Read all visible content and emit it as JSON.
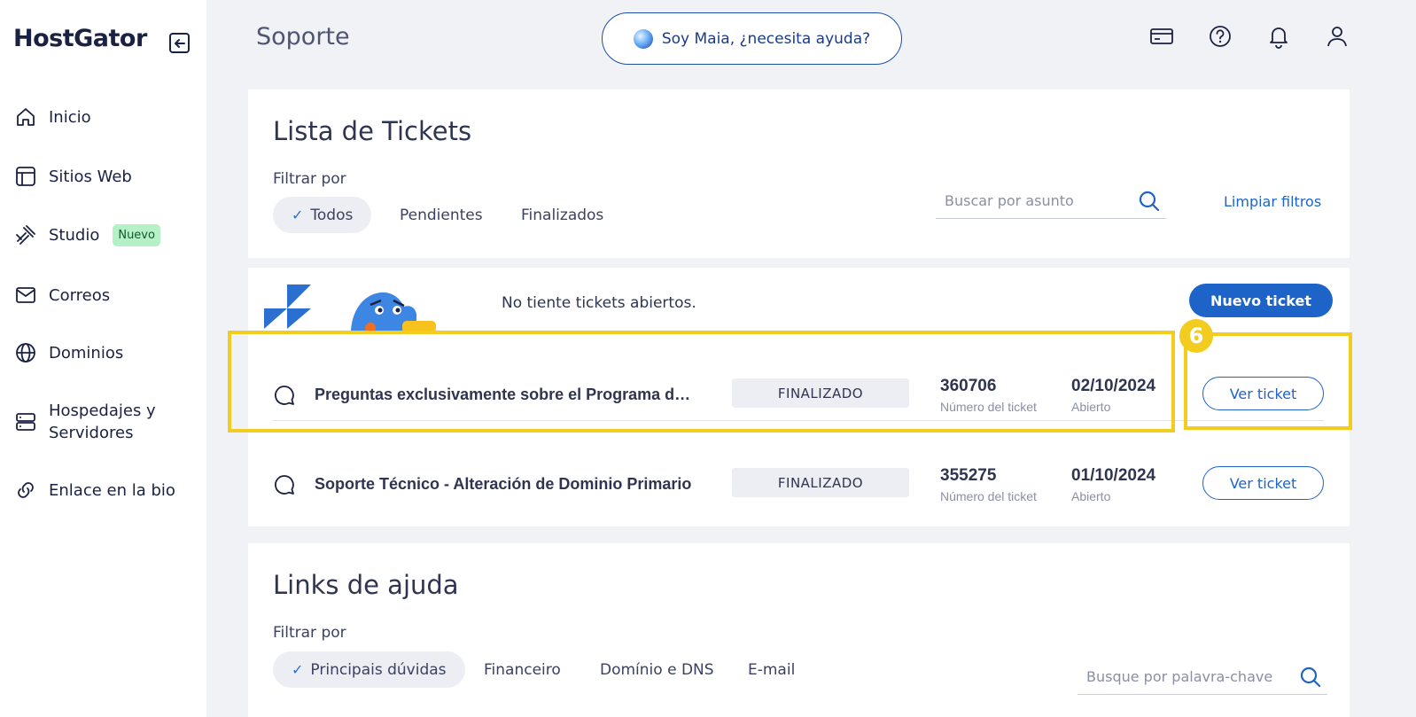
{
  "sidebar": {
    "logo": "HostGator",
    "items": [
      {
        "label": "Inicio",
        "icon": "home-icon"
      },
      {
        "label": "Sitios Web",
        "icon": "layout-icon"
      },
      {
        "label": "Studio",
        "icon": "studio-icon",
        "badge": "Nuevo"
      },
      {
        "label": "Correos",
        "icon": "mail-icon"
      },
      {
        "label": "Dominios",
        "icon": "globe-icon"
      },
      {
        "label_line1": "Hospedajes y",
        "label_line2": "Servidores",
        "icon": "server-icon"
      },
      {
        "label": "Enlace en la bio",
        "icon": "link-icon"
      }
    ]
  },
  "header": {
    "title": "Soporte",
    "maia_label": "Soy Maia, ¿necesita ayuda?",
    "icons": [
      "billing-card-icon",
      "help-icon",
      "bell-icon",
      "user-icon"
    ]
  },
  "tickets_filter": {
    "title": "Lista de Tickets",
    "filter_label": "Filtrar por",
    "chips": [
      "Todos",
      "Pendientes",
      "Finalizados"
    ],
    "active_chip": "Todos",
    "search_placeholder": "Buscar por asunto",
    "clear_filters": "Limpiar filtros"
  },
  "tickets": {
    "empty_message": "No tiente tickets abiertos.",
    "new_ticket_label": "Nuevo ticket",
    "number_label": "Número del ticket",
    "date_label": "Abierto",
    "view_label": "Ver ticket",
    "step_badge": "6",
    "rows": [
      {
        "subject": "Preguntas exclusivamente sobre el Programa de ...",
        "status": "FINALIZADO",
        "number": "360706",
        "date": "02/10/2024"
      },
      {
        "subject": "Soporte Técnico - Alteración de Dominio Primario",
        "status": "FINALIZADO",
        "number": "355275",
        "date": "01/10/2024"
      }
    ]
  },
  "help_links": {
    "title": "Links de ajuda",
    "filter_label": "Filtrar por",
    "chips": [
      "Principais dúvidas",
      "Financeiro",
      "Domínio e DNS",
      "E-mail"
    ],
    "active_chip": "Principais dúvidas",
    "search_placeholder": "Busque por palavra-chave"
  },
  "colors": {
    "accent": "#1e63c8",
    "highlight": "#f2cc1f",
    "badge_new_bg": "#b6f0c6"
  }
}
